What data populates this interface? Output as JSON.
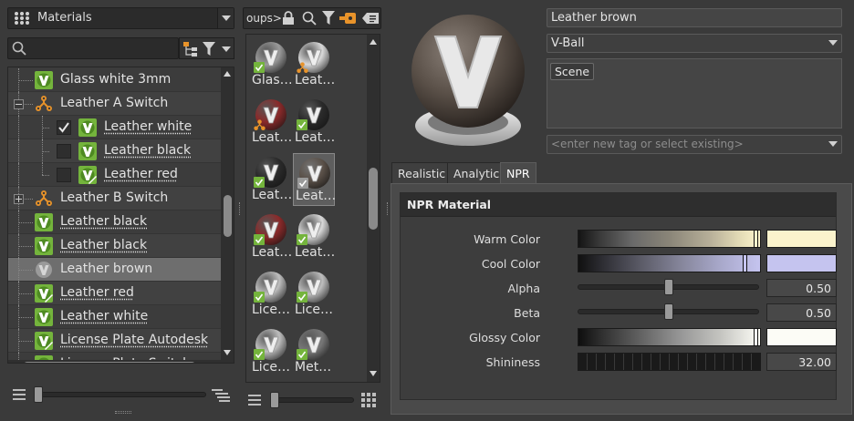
{
  "left": {
    "library_combo": "Materials",
    "search": {
      "value": "",
      "placeholder": ""
    },
    "tree": [
      {
        "label": "Glass white 3mm",
        "kind": "material",
        "level": 0,
        "link": false
      },
      {
        "label": "Leather A Switch",
        "kind": "switch",
        "level": 0,
        "expanded": true,
        "link": false
      },
      {
        "label": "Leather white",
        "kind": "material",
        "level": 1,
        "checked": true,
        "link": true
      },
      {
        "label": "Leather black",
        "kind": "material",
        "level": 1,
        "checked": false,
        "link": true
      },
      {
        "label": "Leather red",
        "kind": "material-edited",
        "level": 1,
        "checked": false,
        "link": true
      },
      {
        "label": "Leather B Switch",
        "kind": "switch",
        "level": 0,
        "expanded": false,
        "link": false
      },
      {
        "label": "Leather black",
        "kind": "material",
        "level": 0,
        "link": true
      },
      {
        "label": "Leather black",
        "kind": "material",
        "level": 0,
        "link": true
      },
      {
        "label": "Leather brown",
        "kind": "material-grey",
        "level": 0,
        "selected": true,
        "link": false
      },
      {
        "label": "Leather red",
        "kind": "material-edited",
        "level": 0,
        "link": true
      },
      {
        "label": "Leather white",
        "kind": "material",
        "level": 0,
        "link": true
      },
      {
        "label": "License Plate Autodesk",
        "kind": "material-edited",
        "level": 0,
        "link": true
      },
      {
        "label": "License Plate Switch",
        "kind": "material",
        "level": 0,
        "link": true
      }
    ]
  },
  "middle": {
    "groups_label": "oups>",
    "thumbnails": [
      {
        "label": "Glas…",
        "ball": "#9a9a9a",
        "badge": "green"
      },
      {
        "label": "Leat…",
        "ball": "#d8d8d8",
        "badge": "switch"
      },
      {
        "label": "Leat…",
        "ball": "#8a2a2a",
        "badge": "switch"
      },
      {
        "label": "Leat…",
        "ball": "#2a2a2a",
        "badge": "green"
      },
      {
        "label": "Leat…",
        "ball": "#2a2a2a",
        "badge": "green"
      },
      {
        "label": "Leat…",
        "ball": "#5a5048",
        "badge": "grey",
        "selected": true
      },
      {
        "label": "Leat…",
        "ball": "#8a2a2a",
        "badge": "green"
      },
      {
        "label": "Leat…",
        "ball": "#d8d8d8",
        "badge": "green"
      },
      {
        "label": "Lice…",
        "ball": "#bdbdbd",
        "badge": "green"
      },
      {
        "label": "Lice…",
        "ball": "#bdbdbd",
        "badge": "green"
      },
      {
        "label": "Lice…",
        "ball": "#bdbdbd",
        "badge": "green"
      },
      {
        "label": "Met…",
        "ball": "#777777",
        "badge": "green"
      }
    ]
  },
  "right": {
    "material_name": "Leather brown",
    "material_type": "V-Ball",
    "scene_tag": "Scene",
    "tag_placeholder": "<enter new tag or select existing>",
    "tabs": [
      {
        "label": "Realistic",
        "active": false
      },
      {
        "label": "Analytic",
        "active": false
      },
      {
        "label": "NPR",
        "active": true
      }
    ],
    "section_title": "NPR Material",
    "properties": {
      "warm_color": {
        "label": "Warm Color",
        "swatch": "#fbf3cc"
      },
      "cool_color": {
        "label": "Cool Color",
        "swatch": "#c5c4ef"
      },
      "alpha": {
        "label": "Alpha",
        "value": "0.50",
        "fraction": 0.5
      },
      "beta": {
        "label": "Beta",
        "value": "0.50",
        "fraction": 0.5
      },
      "glossy_color": {
        "label": "Glossy Color",
        "swatch": "#fcfcf6"
      },
      "shininess": {
        "label": "Shininess",
        "value": "32.00"
      }
    }
  },
  "colors": {
    "material_green": "#74b43c",
    "switch_orange": "#e8932a",
    "panel_bg": "#3a3a3a",
    "selection": "#6e6e6e"
  }
}
